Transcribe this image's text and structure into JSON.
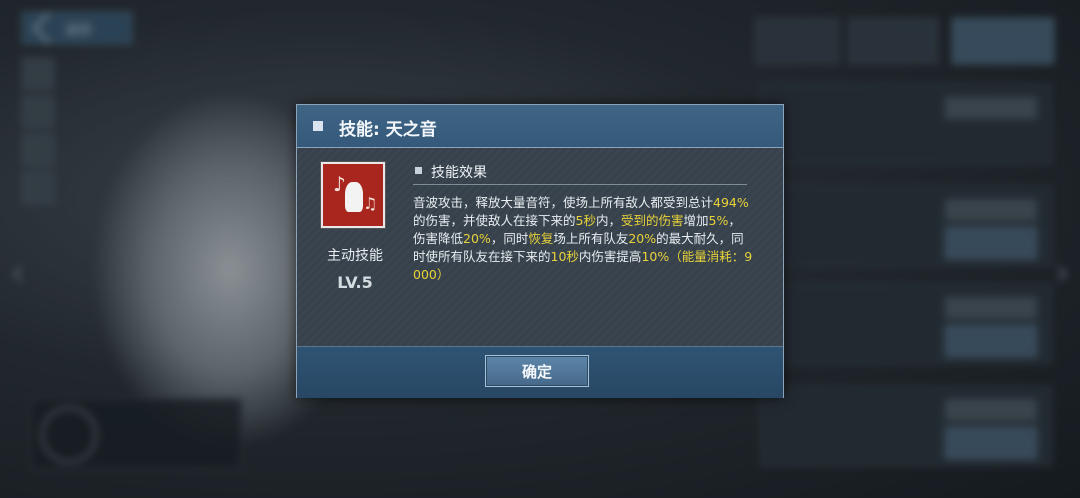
{
  "background": {
    "back_label": "返回"
  },
  "dialog": {
    "title": "技能: 天之音",
    "skill_type": "主动技能",
    "skill_level": "LV.5",
    "section_title": "技能效果",
    "description": [
      {
        "text": "音波攻击，释放大量音符，使场上所有敌人都受到总计",
        "highlight": false
      },
      {
        "text": "494%",
        "highlight": true
      },
      {
        "text": "的伤害，并使敌人在接下来的",
        "highlight": false
      },
      {
        "text": "5秒",
        "highlight": true
      },
      {
        "text": "内，",
        "highlight": false
      },
      {
        "text": "受到的伤害",
        "highlight": true
      },
      {
        "text": "增加",
        "highlight": false
      },
      {
        "text": "5%",
        "highlight": true
      },
      {
        "text": "，伤害降低",
        "highlight": false
      },
      {
        "text": "20%",
        "highlight": true
      },
      {
        "text": "，同时",
        "highlight": false
      },
      {
        "text": "恢复",
        "highlight": true
      },
      {
        "text": "场上所有队友",
        "highlight": false
      },
      {
        "text": "20%",
        "highlight": true
      },
      {
        "text": "的最大耐久，同时使所有队友在接下来的",
        "highlight": false
      },
      {
        "text": "10秒",
        "highlight": true
      },
      {
        "text": "内伤害提高",
        "highlight": false
      },
      {
        "text": "10%（能量消耗：9000）",
        "highlight": true
      }
    ],
    "confirm_label": "确定"
  },
  "colors": {
    "highlight": "#e8d23a",
    "header": "#3f6586",
    "skill_icon_bg": "#a8261e"
  },
  "icons": [
    "back-chevron-icon",
    "skill-icon",
    "left-arrow-icon",
    "right-arrow-icon"
  ]
}
